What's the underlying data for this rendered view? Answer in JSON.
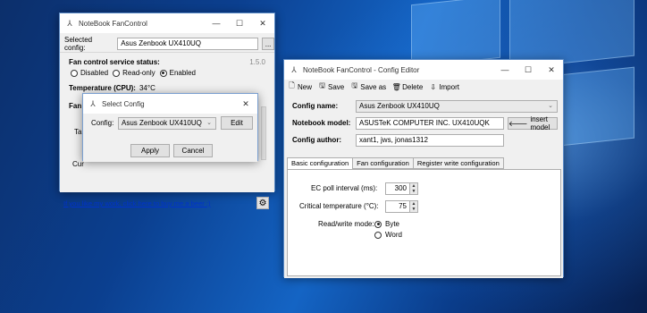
{
  "main_window": {
    "title": "NoteBook FanControl",
    "selected_config_label": "Selected config:",
    "selected_config_value": "Asus Zenbook UX410UQ",
    "browse_label": "...",
    "service_status_label": "Fan control service status:",
    "version": "1.5.0",
    "status_options": [
      {
        "label": "Disabled",
        "selected": false
      },
      {
        "label": "Read-only",
        "selected": false
      },
      {
        "label": "Enabled",
        "selected": true
      }
    ],
    "temperature_label": "Temperature (CPU):",
    "temperature_value": "34°C",
    "fan_label_partial": "Fan #",
    "target_label_partial": "Targ",
    "current_label_partial": "Cur",
    "donate_link": "If you like my work, click here to buy me a beer :)",
    "settings_icon": "gear-icon"
  },
  "select_dialog": {
    "title": "Select Config",
    "config_label": "Config:",
    "config_value": "Asus Zenbook UX410UQ",
    "edit_label": "Edit",
    "apply_label": "Apply",
    "cancel_label": "Cancel"
  },
  "editor_window": {
    "title": "NoteBook FanControl - Config Editor",
    "toolbar": [
      {
        "label": "New",
        "icon": "new-file-icon"
      },
      {
        "label": "Save",
        "icon": "save-icon"
      },
      {
        "label": "Save as",
        "icon": "save-as-icon"
      },
      {
        "label": "Delete",
        "icon": "delete-icon"
      },
      {
        "label": "Import",
        "icon": "import-icon"
      }
    ],
    "config_name_label": "Config name:",
    "config_name_value": "Asus Zenbook UX410UQ",
    "notebook_model_label": "Notebook model:",
    "notebook_model_value": "ASUSTeK COMPUTER INC. UX410UQK",
    "insert_model_label": "insert model",
    "config_author_label": "Config author:",
    "config_author_value": "xant1, jws, jonas1312",
    "tabs": [
      {
        "label": "Basic configuration",
        "active": true
      },
      {
        "label": "Fan configuration",
        "active": false
      },
      {
        "label": "Register write configuration",
        "active": false
      }
    ],
    "ec_poll_label": "EC poll interval (ms):",
    "ec_poll_value": "300",
    "critical_temp_label": "Critical temperature (°C):",
    "critical_temp_value": "75",
    "rw_mode_label": "Read/write mode:",
    "rw_options": [
      {
        "label": "Byte",
        "selected": true
      },
      {
        "label": "Word",
        "selected": false
      }
    ]
  },
  "colors": {
    "window_border": "#5a8ac6",
    "link": "#0033cc",
    "desktop": "#0b3f8f"
  }
}
